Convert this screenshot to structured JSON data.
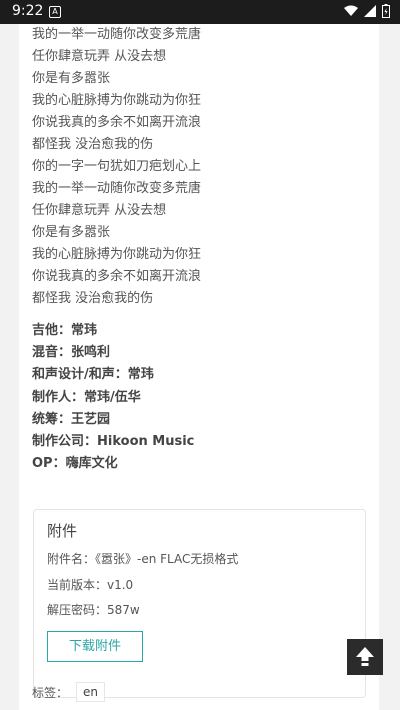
{
  "status": {
    "time": "9:22"
  },
  "lyrics": [
    "我的一举一动随你改变多荒唐",
    "任你肆意玩弄 从没去想",
    "你是有多嚣张",
    "我的心脏脉搏为你跳动为你狂",
    "你说我真的多余不如离开流浪",
    "都怪我 没治愈我的伤",
    "你的一字一句犹如刀疤划心上",
    "我的一举一动随你改变多荒唐",
    "任你肆意玩弄 从没去想",
    "你是有多嚣张",
    "我的心脏脉搏为你跳动为你狂",
    "你说我真的多余不如离开流浪",
    "都怪我 没治愈我的伤"
  ],
  "credits": [
    "吉他：常玮",
    "混音：张鸣利",
    "和声设计/和声：常玮",
    "制作人：常玮/伍华",
    "统筹：王艺园",
    "制作公司：Hikoon Music",
    "OP：嗨库文化"
  ],
  "attachment": {
    "title": "附件",
    "name": "附件名：《嚣张》-en FLAC无损格式",
    "version": "当前版本：v1.0",
    "password": "解压密码：587w",
    "download_label": "下载附件"
  },
  "tags": {
    "label": "标签：",
    "items": [
      "en"
    ]
  }
}
